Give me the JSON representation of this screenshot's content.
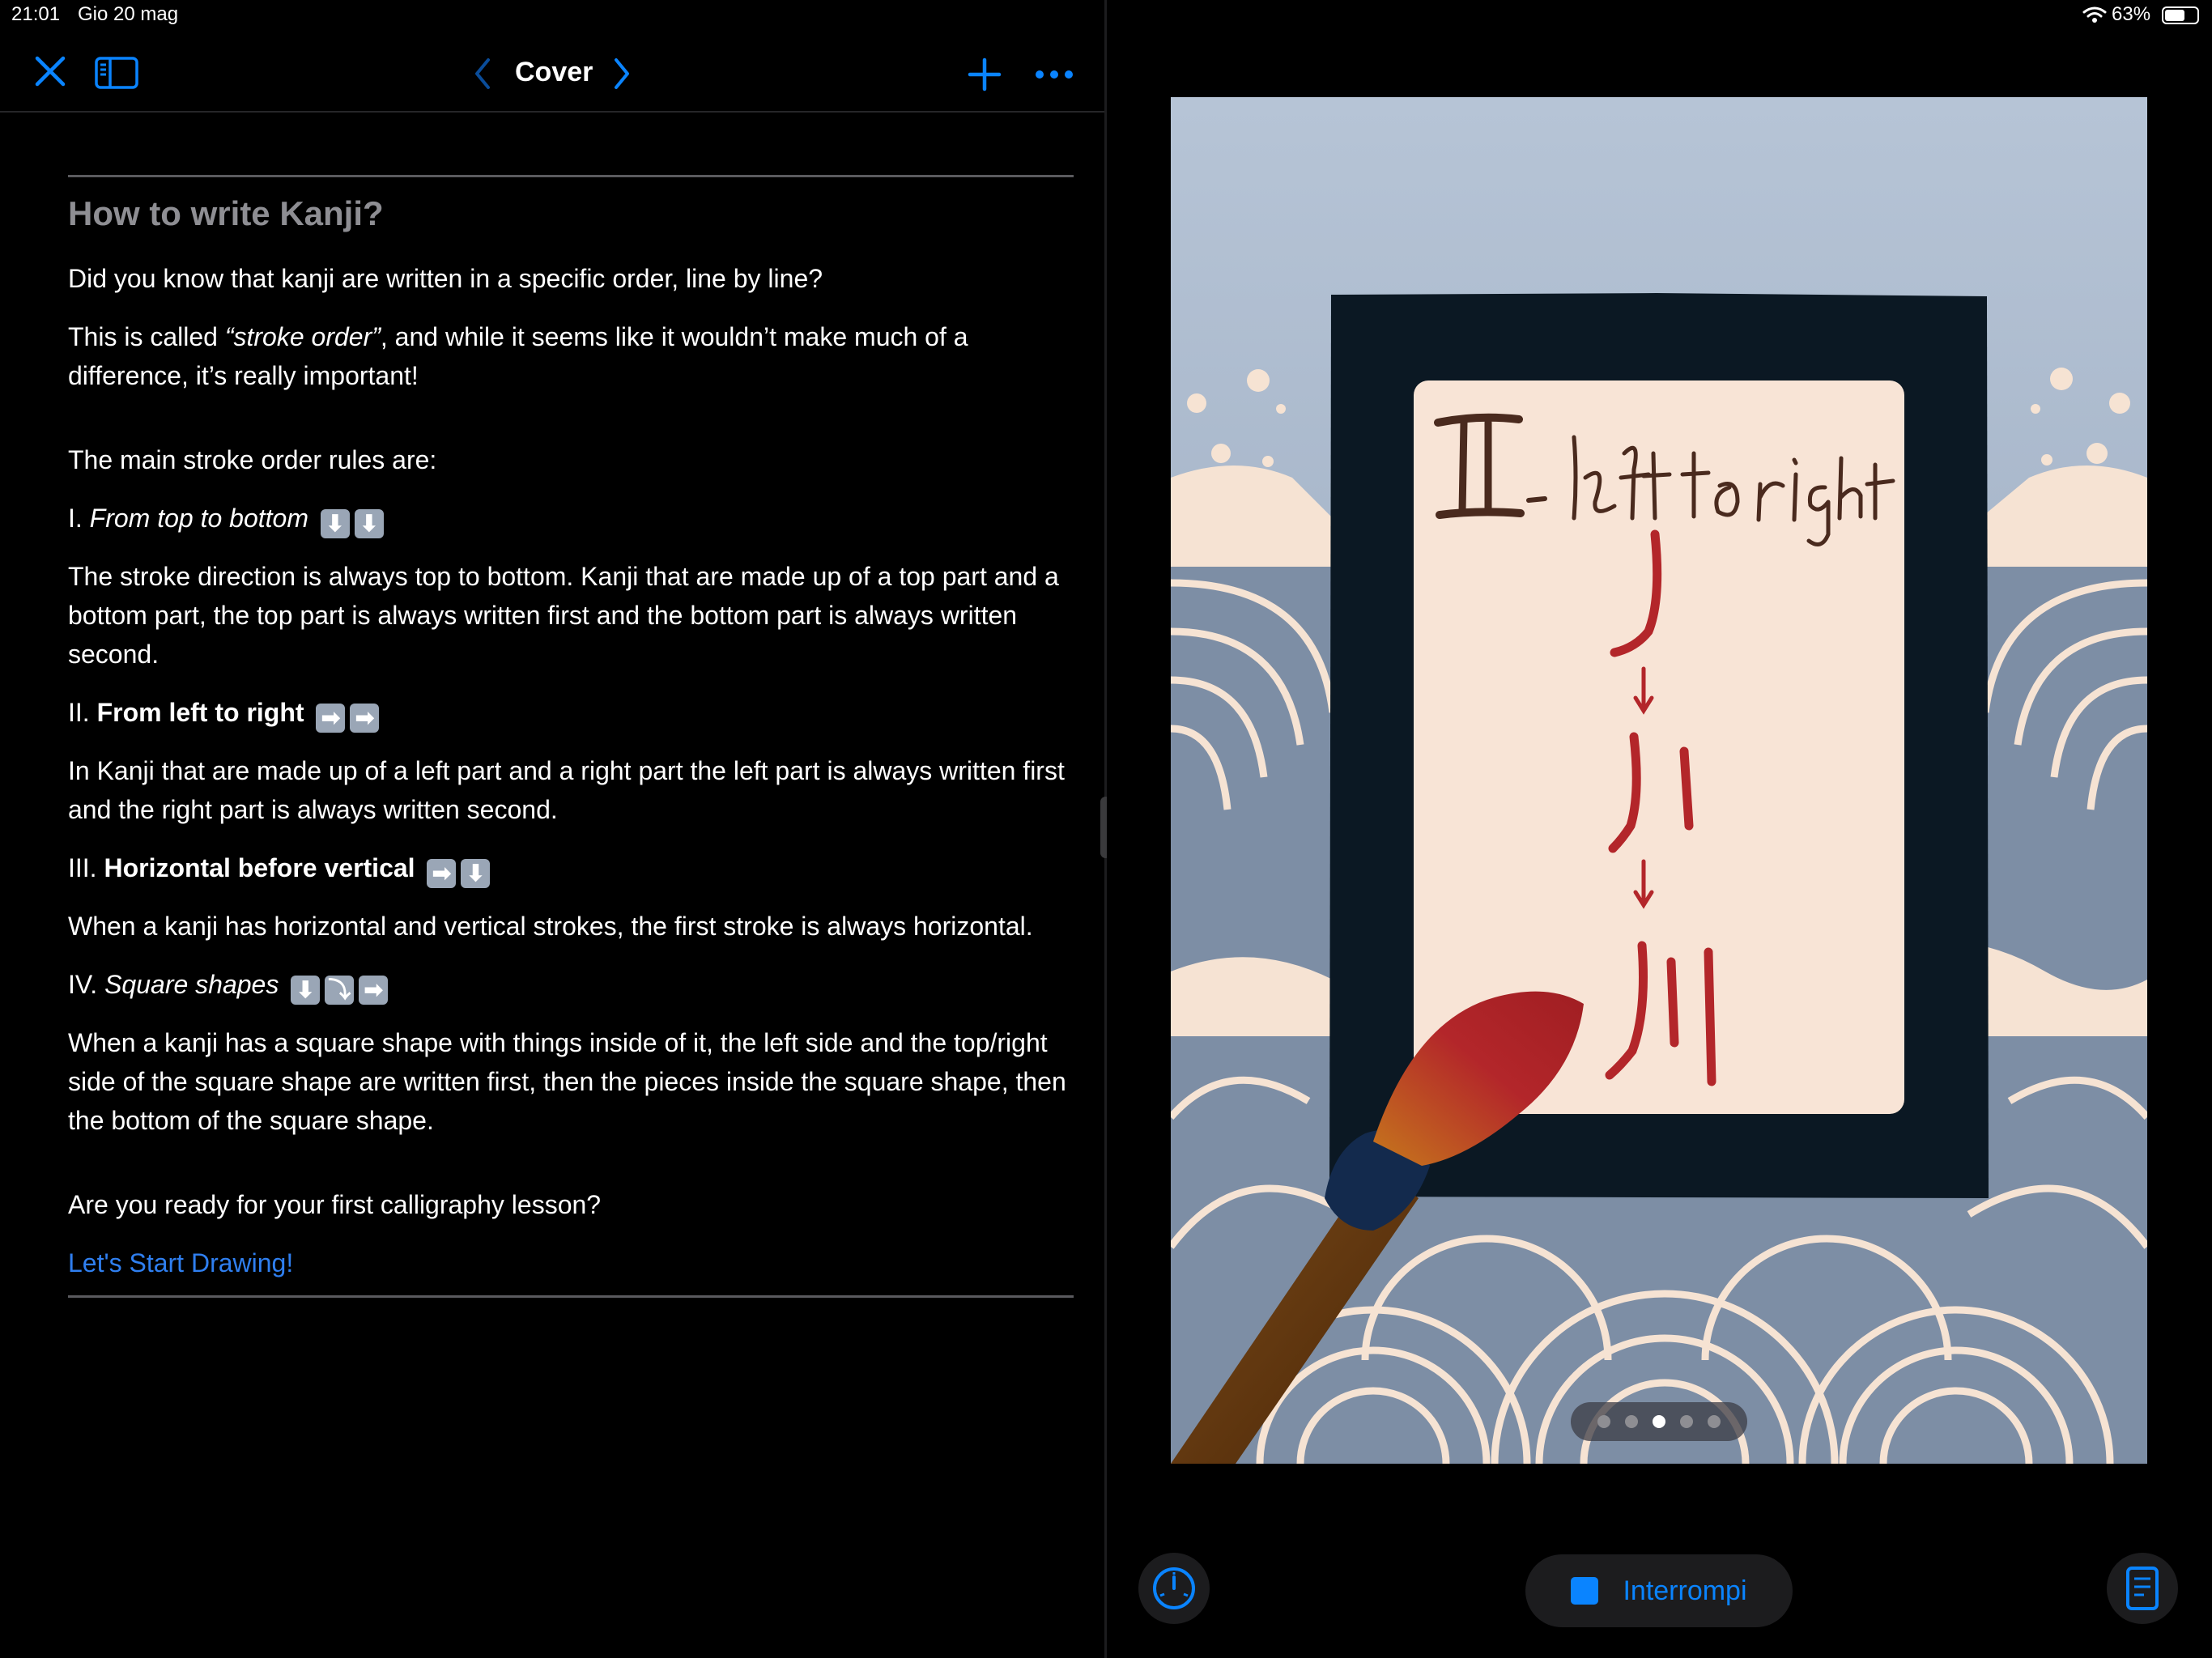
{
  "status_bar": {
    "time": "21:01",
    "date": "Gio 20 mag",
    "battery_percent": "63%",
    "battery_level": 0.63,
    "wifi_icon": "wifi-icon"
  },
  "nav": {
    "title": "Cover",
    "icons": [
      "close-icon",
      "sidebar-icon",
      "chevron-left-icon",
      "chevron-right-icon",
      "plus-icon",
      "more-icon"
    ]
  },
  "doc": {
    "heading": "How to write Kanji?",
    "intro": "Did you know that kanji are written in a specific order, line by line?",
    "p2_before": "This is called ",
    "p2_italic": "“stroke order”",
    "p2_after": ", and while it seems like it wouldn’t make much of a difference, it’s really important!",
    "rules_intro": "The main stroke order rules are:",
    "rule1_num": "I. ",
    "rule1_title": "From top to bottom",
    "rule1_emoji": [
      "⬇",
      "⬇"
    ],
    "rule1_text": "The stroke direction is always top to bottom. Kanji that are made up of a top part and a bottom part, the top part is always written first and the bottom part is always written second.",
    "rule2_num": "II. ",
    "rule2_title": "From left to right",
    "rule2_emoji": [
      "➡",
      "➡"
    ],
    "rule2_text": "In Kanji that are made up of a left part and a right part the left part is always written first and the right part is always written second.",
    "rule3_num": "III. ",
    "rule3_title": "Horizontal before vertical",
    "rule3_emoji": [
      "➡",
      "⬇"
    ],
    "rule3_text": "When a kanji has horizontal and vertical strokes, the first stroke is always horizontal.",
    "rule4_num": "IV. ",
    "rule4_title": "Square shapes",
    "rule4_emoji": [
      "⬇",
      "⤵",
      "➡"
    ],
    "rule4_text": "When a kanji has a square shape with things inside of it, the left side and the top/right side of the square shape are written first, then the pieces inside the square shape, then the bottom of the square shape.",
    "ready": "Are you ready for your first calligraphy lesson?",
    "cta_link": "Let's Start Drawing!"
  },
  "artwork": {
    "card_title": "Ⅱ. left to right",
    "kanji_steps": [
      "丿",
      "川"
    ],
    "colors": {
      "sky": "#b4c2d4",
      "frame": "#0b1823",
      "card": "#f8e4d6",
      "ink_red": "#b3262a",
      "wave": "#7d8ea5",
      "foam": "#f6e3d3",
      "brush_handle": "#6a3a12"
    }
  },
  "pager": {
    "count": 5,
    "active_index": 2
  },
  "bottom_bar": {
    "stop_label": "Interrompi",
    "left_icon": "speedometer-icon",
    "right_icon": "document-icon"
  },
  "colors": {
    "accent": "#0a84ff",
    "link": "#2f7ff0",
    "heading_gray": "#8e8e93"
  }
}
